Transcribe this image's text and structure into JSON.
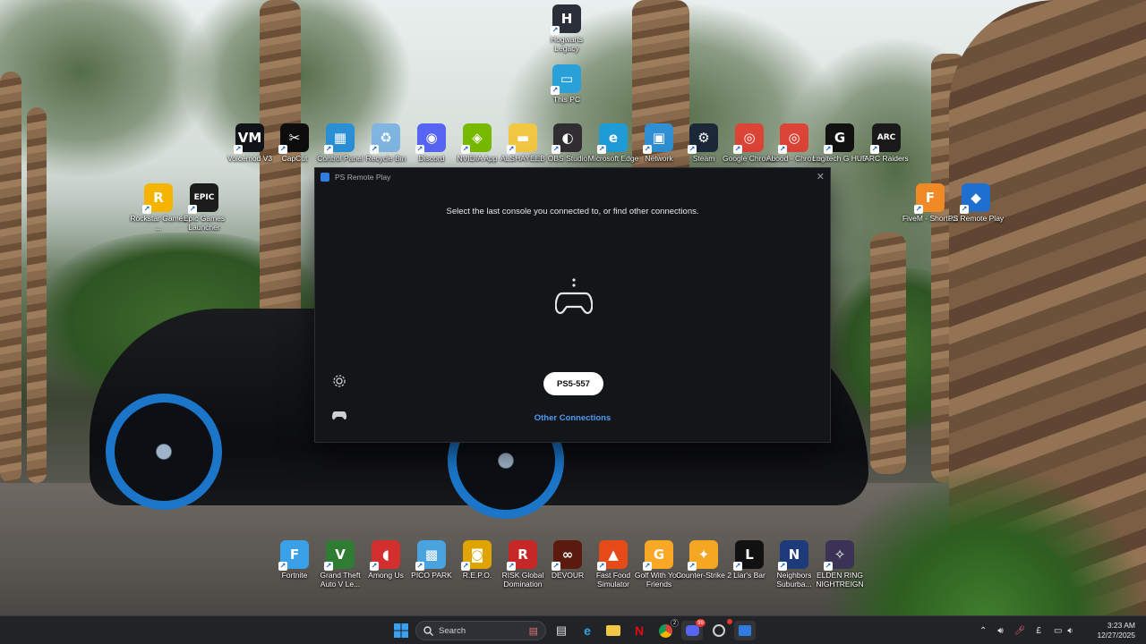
{
  "desktop_icons": [
    {
      "label": "Hogwarts Legacy",
      "glyph": "H",
      "color": "#2a2f3a",
      "icon": "hogwarts-legacy-icon"
    },
    {
      "label": "This PC",
      "glyph": "▭",
      "color": "#2aa0d8",
      "icon": "this-pc-icon"
    },
    {
      "label": "Voicemod V3",
      "glyph": "VM",
      "color": "#101418",
      "icon": "voicemod-icon"
    },
    {
      "label": "CapCut",
      "glyph": "✂",
      "color": "#0d0d0d",
      "icon": "capcut-icon"
    },
    {
      "label": "Control Panel",
      "glyph": "▦",
      "color": "#2b8fd6",
      "icon": "control-panel-icon"
    },
    {
      "label": "Recycle Bin",
      "glyph": "♻",
      "color": "#7fb5e0",
      "icon": "recycle-bin-icon"
    },
    {
      "label": "Discord",
      "glyph": "◉",
      "color": "#5865f2",
      "icon": "discord-icon"
    },
    {
      "label": "NVIDIA App",
      "glyph": "◈",
      "color": "#76b900",
      "icon": "nvidia-icon"
    },
    {
      "label": "ALSHAYEEB",
      "glyph": "▬",
      "color": "#f2c744",
      "icon": "folder-icon"
    },
    {
      "label": "OBS Studio",
      "glyph": "◐",
      "color": "#302e31",
      "icon": "obs-icon"
    },
    {
      "label": "Microsoft Edge",
      "glyph": "e",
      "color": "#1f9cd8",
      "icon": "edge-icon"
    },
    {
      "label": "Network",
      "glyph": "▣",
      "color": "#2f8fd0",
      "icon": "network-icon"
    },
    {
      "label": "Steam",
      "glyph": "⚙",
      "color": "#1b2838",
      "icon": "steam-icon"
    },
    {
      "label": "Google Chrome",
      "glyph": "◎",
      "color": "#db4437",
      "icon": "chrome-icon"
    },
    {
      "label": "Abood - Chrome",
      "glyph": "◎",
      "color": "#db4437",
      "icon": "chrome-profile-icon"
    },
    {
      "label": "Logitech G HUB",
      "glyph": "G",
      "color": "#111",
      "icon": "logitech-icon"
    },
    {
      "label": "ARC Raiders",
      "glyph": "ARC",
      "color": "#1a1a1a",
      "icon": "arc-raiders-icon"
    },
    {
      "label": "Rockstar Games ...",
      "glyph": "R",
      "color": "#f4b400",
      "icon": "rockstar-icon"
    },
    {
      "label": "Epic Games Launcher",
      "glyph": "EPIC",
      "color": "#1c1c1c",
      "icon": "epic-games-icon"
    },
    {
      "label": "FiveM - Shortcut",
      "glyph": "F",
      "color": "#f08a24",
      "icon": "fivem-icon"
    },
    {
      "label": "PS Remote Play",
      "glyph": "◆",
      "color": "#1f6fd1",
      "icon": "ps-remote-play-icon"
    },
    {
      "label": "Fortnite",
      "glyph": "F",
      "color": "#3aa0e8",
      "icon": "fortnite-icon"
    },
    {
      "label": "Grand Theft Auto V Le...",
      "glyph": "V",
      "color": "#2e7d32",
      "icon": "gta-icon"
    },
    {
      "label": "Among Us",
      "glyph": "◖",
      "color": "#d32f2f",
      "icon": "among-us-icon"
    },
    {
      "label": "PICO PARK",
      "glyph": "▩",
      "color": "#4aa3df",
      "icon": "pico-park-icon"
    },
    {
      "label": "R.E.P.O.",
      "glyph": "◙",
      "color": "#e0a400",
      "icon": "repo-icon"
    },
    {
      "label": "RISK Global Domination",
      "glyph": "R",
      "color": "#c62828",
      "icon": "risk-icon"
    },
    {
      "label": "DEVOUR",
      "glyph": "∞",
      "color": "#5a1a0d",
      "icon": "devour-icon"
    },
    {
      "label": "Fast Food Simulator",
      "glyph": "▲",
      "color": "#e64a19",
      "icon": "fast-food-icon"
    },
    {
      "label": "Golf With Your Friends",
      "glyph": "G",
      "color": "#f9a825",
      "icon": "golf-icon"
    },
    {
      "label": "Counter-Strike 2",
      "glyph": "✦",
      "color": "#f5a623",
      "icon": "counter-strike-icon"
    },
    {
      "label": "Liar's Bar",
      "glyph": "L",
      "color": "#111",
      "icon": "liars-bar-icon"
    },
    {
      "label": "Neighbors Suburba...",
      "glyph": "N",
      "color": "#1d3b7a",
      "icon": "neighbors-icon"
    },
    {
      "label": "ELDEN RING NIGHTREIGN",
      "glyph": "✧",
      "color": "#3a3355",
      "icon": "elden-ring-icon"
    }
  ],
  "window": {
    "title": "PS Remote Play",
    "prompt": "Select the last console you connected to, or find other connections.",
    "console_button": "PS5-557",
    "other_connections": "Other Connections"
  },
  "taskbar": {
    "search_placeholder": "Search",
    "language": "£",
    "time": "3:23 AM",
    "date": "12/27/2025",
    "chrome_badge": "2",
    "discord_badge": "99"
  }
}
